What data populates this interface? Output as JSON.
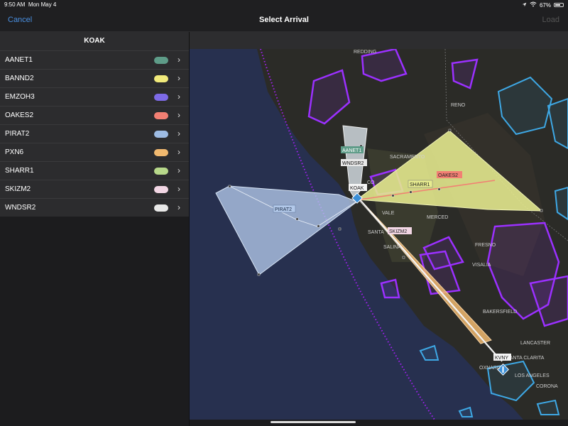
{
  "status_bar": {
    "time": "9:50 AM",
    "date": "Mon May 4",
    "battery": "67%",
    "battery_level": 0.67,
    "wifi_icon": "wifi-icon",
    "location_icon": "location-arrow-icon"
  },
  "nav": {
    "cancel": "Cancel",
    "title": "Select Arrival",
    "load": "Load"
  },
  "sidebar": {
    "airport": "KOAK",
    "procedures": [
      {
        "name": "AANET1",
        "color": "#5e9c88"
      },
      {
        "name": "BANND2",
        "color": "#f1ea7b"
      },
      {
        "name": "EMZOH3",
        "color": "#7d6ae6"
      },
      {
        "name": "OAKES2",
        "color": "#f27f73"
      },
      {
        "name": "PIRAT2",
        "color": "#9dbbe3"
      },
      {
        "name": "PXN6",
        "color": "#f1b96f"
      },
      {
        "name": "SHARR1",
        "color": "#b7d88a"
      },
      {
        "name": "SKIZM2",
        "color": "#f2d6e4"
      },
      {
        "name": "WNDSR2",
        "color": "#e8e8e8"
      }
    ]
  },
  "map": {
    "cities": {
      "redding": "REDDING",
      "reno": "RENO",
      "sacramento": "SACRAMENTO",
      "merced": "MERCED",
      "fresno": "FRESNO",
      "visalia": "VISALIA",
      "bakersfield": "BAKERSFIELD",
      "lancaster": "LANCASTER",
      "santa_clarita": "SANTA CLARITA",
      "oxnard": "OXNARD",
      "los_angeles": "LOS ANGELES",
      "corona": "CORONA",
      "vale": "VALE",
      "santa": "SANTA",
      "salina": "SALINA"
    },
    "labels": {
      "koak": "KOAK",
      "kvny": "KVNY",
      "aanet1": "AANET1",
      "wndsr2": "WNDSR2",
      "pirat2": "PIRAT2",
      "sharr1": "SHARR1",
      "oakes2": "OAKES2",
      "skizm2": "SKIZM2",
      "co": "CO"
    }
  }
}
